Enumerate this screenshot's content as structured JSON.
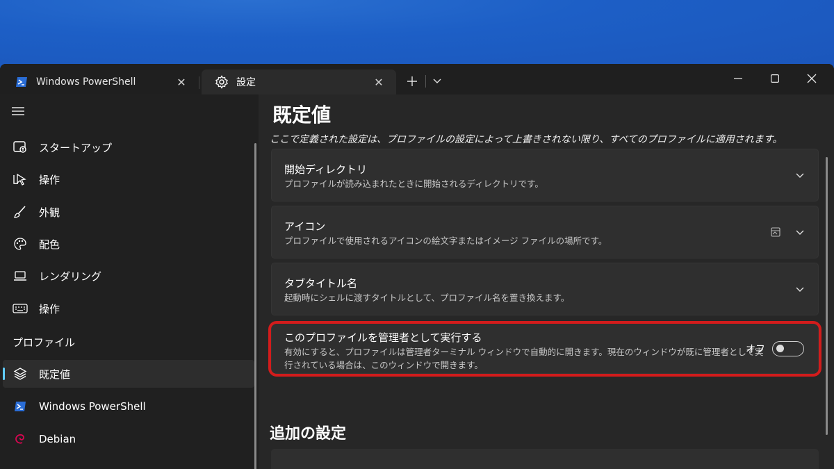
{
  "tabs": [
    {
      "label": "Windows PowerShell",
      "icon": "powershell-icon"
    },
    {
      "label": "設定",
      "icon": "gear-icon"
    }
  ],
  "window_controls": [
    "minimize",
    "maximize",
    "close"
  ],
  "sidebar": {
    "items": [
      {
        "label": "スタートアップ",
        "icon": "startup-icon"
      },
      {
        "label": "操作",
        "icon": "interaction-icon"
      },
      {
        "label": "外観",
        "icon": "brush-icon"
      },
      {
        "label": "配色",
        "icon": "palette-icon"
      },
      {
        "label": "レンダリング",
        "icon": "laptop-icon"
      },
      {
        "label": "操作",
        "icon": "keyboard-icon"
      }
    ],
    "profiles_label": "プロファイル",
    "profiles": [
      {
        "label": "既定値",
        "icon": "layers-icon",
        "selected": true
      },
      {
        "label": "Windows PowerShell",
        "icon": "powershell-icon"
      },
      {
        "label": "Debian",
        "icon": "debian-icon"
      }
    ]
  },
  "main": {
    "title": "既定値",
    "description": "ここで定義された設定は、プロファイルの設定によって上書きされない限り、すべてのプロファイルに適用されます。",
    "cards": [
      {
        "title": "開始ディレクトリ",
        "desc": "プロファイルが読み込まれたときに開始されるディレクトリです。"
      },
      {
        "title": "アイコン",
        "desc": "プロファイルで使用されるアイコンの絵文字またはイメージ ファイルの場所です。"
      },
      {
        "title": "タブタイトル名",
        "desc": "起動時にシェルに渡すタイトルとして、プロファイル名を置き換えます。"
      }
    ],
    "elevate": {
      "title": "このプロファイルを管理者として実行する",
      "desc_line1": "有効にすると、プロファイルは管理者ターミナル ウィンドウで自動的に開きます。現在のウィンドウが既に管理者として実",
      "desc_line2": "行されている場合は、このウィンドウで開きます。",
      "toggle_label": "オフ",
      "toggle_on": false
    },
    "section2_title": "追加の設定"
  },
  "colors": {
    "accent": "#60cdff",
    "highlight": "#d21c1c",
    "window_bg": "#272727",
    "sidebar_bg": "#202020",
    "card_bg": "#2f2f2f"
  }
}
